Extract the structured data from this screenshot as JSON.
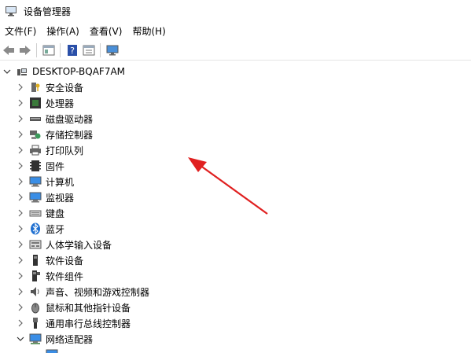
{
  "window": {
    "title": "设备管理器"
  },
  "menu": [
    "文件(F)",
    "操作(A)",
    "查看(V)",
    "帮助(H)"
  ],
  "toolbar": {
    "icons": [
      "back-icon",
      "forward-icon",
      "properties-icon",
      "help-icon",
      "view-icon",
      "monitor-scan-icon"
    ]
  },
  "tree": {
    "root": {
      "label": "DESKTOP-BQAF7AM",
      "icon": "computer-root-icon",
      "expanded": true
    },
    "items": [
      {
        "label": "安全设备",
        "icon": "security-device-icon"
      },
      {
        "label": "处理器",
        "icon": "processor-icon"
      },
      {
        "label": "磁盘驱动器",
        "icon": "disk-drive-icon"
      },
      {
        "label": "存储控制器",
        "icon": "storage-controller-icon"
      },
      {
        "label": "打印队列",
        "icon": "printer-icon"
      },
      {
        "label": "固件",
        "icon": "firmware-icon"
      },
      {
        "label": "计算机",
        "icon": "computer-icon"
      },
      {
        "label": "监视器",
        "icon": "monitor-icon"
      },
      {
        "label": "键盘",
        "icon": "keyboard-icon"
      },
      {
        "label": "蓝牙",
        "icon": "bluetooth-icon"
      },
      {
        "label": "人体学输入设备",
        "icon": "hid-icon"
      },
      {
        "label": "软件设备",
        "icon": "software-device-icon"
      },
      {
        "label": "软件组件",
        "icon": "software-component-icon"
      },
      {
        "label": "声音、视频和游戏控制器",
        "icon": "sound-icon"
      },
      {
        "label": "鼠标和其他指针设备",
        "icon": "mouse-icon"
      },
      {
        "label": "通用串行总线控制器",
        "icon": "usb-icon"
      },
      {
        "label": "网络适配器",
        "icon": "network-adapter-icon",
        "expanded": true
      }
    ]
  },
  "colors": {
    "accent_arrow": "#e02020",
    "folder_icon": "#3a8ee6"
  }
}
